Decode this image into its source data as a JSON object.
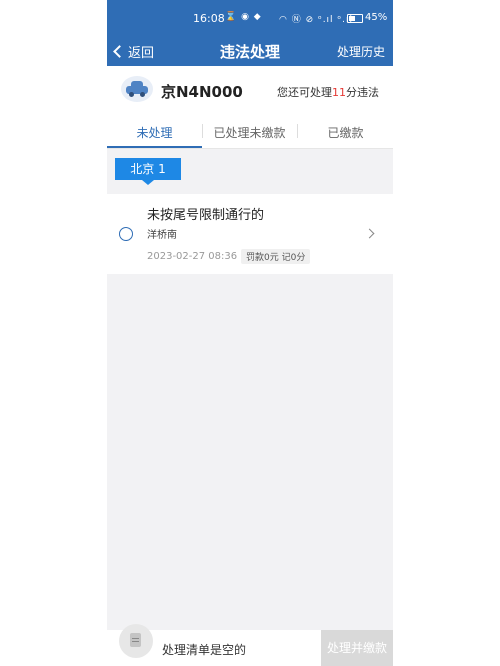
{
  "status_bar": {
    "time": "16:08",
    "left_icons": "⌛ ◉ ◆",
    "right_icons": "◠ Ⓝ ⊘ ᵒ.ıl ᵒ.ıl",
    "battery": "45%"
  },
  "nav": {
    "back_label": "返回",
    "title": "违法处理",
    "history_label": "处理历史"
  },
  "car": {
    "plate": "京N4N000",
    "pending_prefix": "您还可处理",
    "pending_count": "11",
    "pending_suffix": "分违法"
  },
  "tabs": [
    {
      "label": "未处理",
      "active": true
    },
    {
      "label": "已处理未缴款",
      "active": false
    },
    {
      "label": "已缴款",
      "active": false
    }
  ],
  "region": {
    "label": "北京 1"
  },
  "violations": [
    {
      "title": "未按尾号限制通行的",
      "location": "洋桥南",
      "time": "2023-02-27 08:36",
      "penalty": "罚款0元 记0分"
    }
  ],
  "bottom": {
    "empty_text": "处理清单是空的",
    "pay_label": "处理并缴款"
  },
  "colors": {
    "primary": "#2f6db5",
    "accent": "#1e88e5",
    "highlight": "#e53935"
  }
}
